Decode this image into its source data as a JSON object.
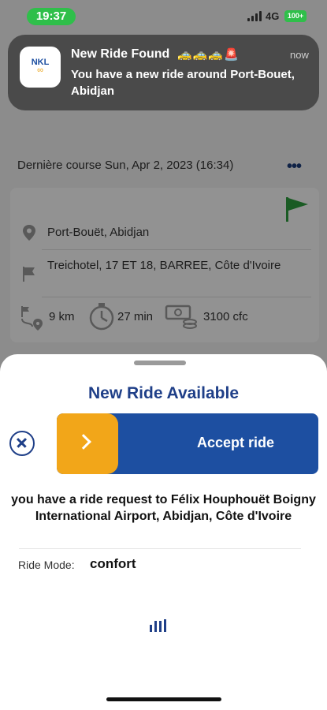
{
  "status_bar": {
    "time": "19:37",
    "network": "4G",
    "battery": "100+"
  },
  "notification": {
    "app_icon_text": "NKL",
    "app_icon_symbol": "∞",
    "title": "New Ride Found",
    "title_emoji": "🚕🚕🚕🚨",
    "time": "now",
    "body": "You have a new ride around Port-Bouet, Abidjan"
  },
  "history": {
    "last_course": "Dernière course Sun, Apr 2, 2023 (16:34)"
  },
  "trip_card": {
    "pickup": "Port-Bouët, Abidjan",
    "destination": "Treichotel, 17 ET 18, BARREE, Côte d'Ivoire",
    "distance": "9 km",
    "duration": "27 min",
    "price": "3100 cfc"
  },
  "ride_sheet": {
    "title": "New Ride Available",
    "accept_label": "Accept ride",
    "request_text": "you have a ride request to Félix Houphouët Boigny International Airport, Abidjan, Côte d'Ivoire",
    "mode_label": "Ride Mode:",
    "mode_value": "confort"
  },
  "colors": {
    "brand_blue": "#1d4fa1",
    "accent_orange": "#f2a619",
    "status_green": "#2fbf4a",
    "flag_green": "#2e9e3e"
  },
  "icons": [
    "location-pin-icon",
    "flag-icon",
    "route-icon",
    "stopwatch-icon",
    "cash-icon",
    "more-dots-icon",
    "close-icon",
    "chevron-right-icon",
    "signal-icon",
    "battery-icon"
  ]
}
